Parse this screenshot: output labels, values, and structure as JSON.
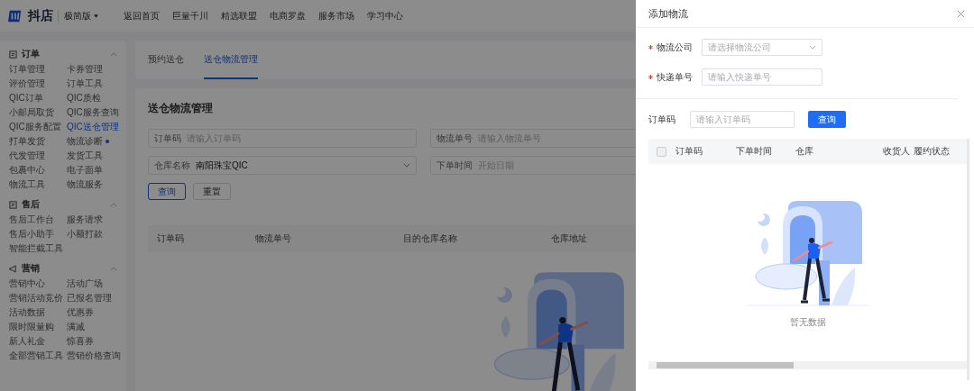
{
  "header": {
    "logo": "抖店",
    "edition": "极简版",
    "nav": [
      {
        "label": "返回首页"
      },
      {
        "label": "巨量千川"
      },
      {
        "label": "精选联盟"
      },
      {
        "label": "电商罗盘"
      },
      {
        "label": "服务市场"
      },
      {
        "label": "学习中心"
      }
    ]
  },
  "sidebar": {
    "groups": [
      {
        "title": "订单",
        "expanded": true,
        "items": [
          {
            "label": "订单管理",
            "selected": false,
            "dot": false
          },
          {
            "label": "卡券管理",
            "selected": false,
            "dot": false
          },
          {
            "label": "评价管理",
            "selected": false,
            "dot": false
          },
          {
            "label": "订单工具",
            "selected": false,
            "dot": false
          },
          {
            "label": "QIC订单",
            "selected": false,
            "dot": false
          },
          {
            "label": "QIC质检",
            "selected": false,
            "dot": false
          },
          {
            "label": "小邮局取货",
            "selected": false,
            "dot": false
          },
          {
            "label": "QIC服务查询",
            "selected": false,
            "dot": false
          },
          {
            "label": "QIC服务配置",
            "selected": false,
            "dot": false
          },
          {
            "label": "QIC送仓管理",
            "selected": true,
            "dot": false
          },
          {
            "label": "打单发货",
            "selected": false,
            "dot": false
          },
          {
            "label": "物流诊断",
            "selected": false,
            "dot": true
          },
          {
            "label": "代发管理",
            "selected": false,
            "dot": false
          },
          {
            "label": "发货工具",
            "selected": false,
            "dot": false
          },
          {
            "label": "包裹中心",
            "selected": false,
            "dot": false
          },
          {
            "label": "电子面单",
            "selected": false,
            "dot": false
          },
          {
            "label": "物流工具",
            "selected": false,
            "dot": false
          },
          {
            "label": "物流服务",
            "selected": false,
            "dot": false
          }
        ]
      },
      {
        "title": "售后",
        "expanded": true,
        "items": [
          {
            "label": "售后工作台",
            "selected": false,
            "dot": false
          },
          {
            "label": "服务请求",
            "selected": false,
            "dot": false
          },
          {
            "label": "售后小助手",
            "selected": false,
            "dot": false
          },
          {
            "label": "小额打款",
            "selected": false,
            "dot": false
          },
          {
            "label": "智能拦截工具",
            "selected": false,
            "dot": false
          }
        ]
      },
      {
        "title": "营销",
        "expanded": true,
        "items": [
          {
            "label": "营销中心",
            "selected": false,
            "dot": false
          },
          {
            "label": "活动广场",
            "selected": false,
            "dot": false
          },
          {
            "label": "营销活动竞价",
            "selected": false,
            "dot": false
          },
          {
            "label": "已报名管理",
            "selected": false,
            "dot": false
          },
          {
            "label": "活动数据",
            "selected": false,
            "dot": false
          },
          {
            "label": "优惠券",
            "selected": false,
            "dot": false
          },
          {
            "label": "限时限量购",
            "selected": false,
            "dot": false
          },
          {
            "label": "满减",
            "selected": false,
            "dot": false
          },
          {
            "label": "新人礼金",
            "selected": false,
            "dot": false
          },
          {
            "label": "惊喜券",
            "selected": false,
            "dot": false
          },
          {
            "label": "全部营销工具",
            "selected": false,
            "dot": false
          },
          {
            "label": "营销价格查询",
            "selected": false,
            "dot": false
          }
        ]
      }
    ]
  },
  "main": {
    "tabs": [
      {
        "label": "预约送仓",
        "selected": false
      },
      {
        "label": "送仓物流管理",
        "selected": true
      }
    ],
    "title": "送仓物流管理",
    "filters": [
      {
        "kind": "input",
        "label": "订单码",
        "placeholder": "请输入订单码"
      },
      {
        "kind": "input",
        "label": "物流单号",
        "placeholder": "请输入物流单号"
      },
      {
        "kind": "select",
        "label": "仓库名称",
        "value": "南阳珠宝QIC"
      },
      {
        "kind": "date",
        "label": "下单时间",
        "placeholder": "开始日期"
      }
    ],
    "buttons": [
      {
        "label": "查询",
        "primary": true
      },
      {
        "label": "重置",
        "primary": false
      }
    ],
    "table": {
      "columns": [
        "订单码",
        "物流单号",
        "目的仓库名称",
        "仓库地址"
      ]
    }
  },
  "drawer": {
    "title": "添加物流",
    "fields": [
      {
        "kind": "select",
        "label": "物流公司",
        "required": true,
        "placeholder": "请选择物流公司"
      },
      {
        "kind": "input",
        "label": "快递单号",
        "required": true,
        "placeholder": "请输入快递单号"
      }
    ],
    "search": {
      "label": "订单码",
      "placeholder": "请输入订单码",
      "button": "查询"
    },
    "table": {
      "all_checked": false,
      "columns": [
        "订单码",
        "下单时间",
        "仓库",
        "收货人",
        "履约状态"
      ],
      "empty_text": "暂无数据"
    }
  }
}
